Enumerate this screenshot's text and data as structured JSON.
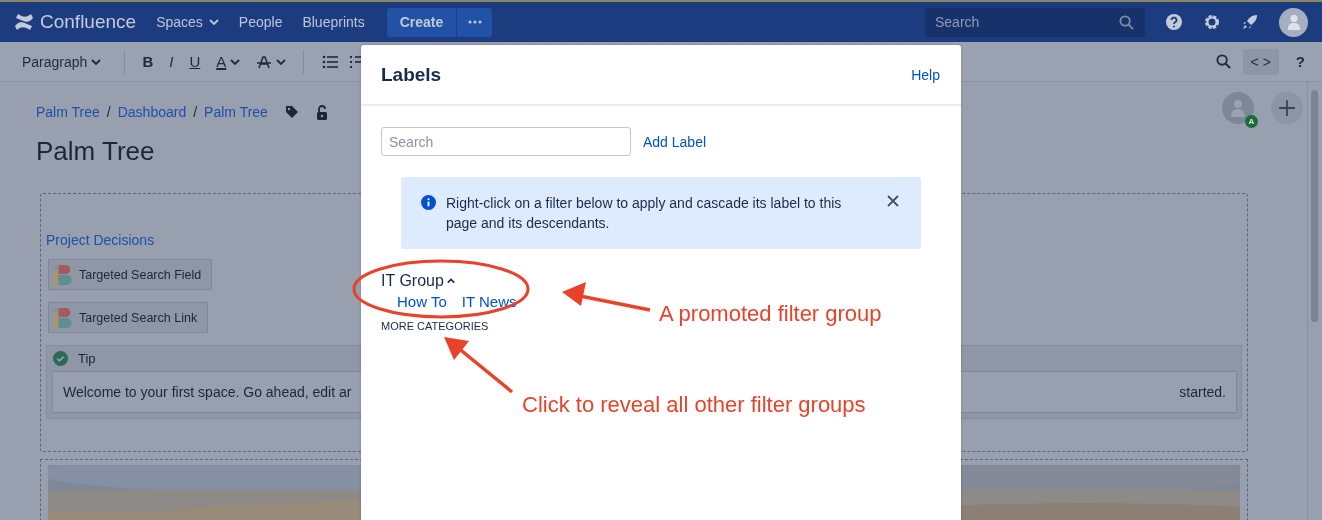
{
  "nav": {
    "logo": "Confluence",
    "items": [
      {
        "label": "Spaces",
        "dropdown": true
      },
      {
        "label": "People",
        "dropdown": false
      },
      {
        "label": "Blueprints",
        "dropdown": false
      }
    ],
    "create": "Create",
    "search": {
      "placeholder": "Search"
    }
  },
  "toolbar": {
    "style": "Paragraph",
    "formats": [
      {
        "kind": "bold",
        "label": "B",
        "dropdown": false
      },
      {
        "kind": "italic",
        "label": "I",
        "dropdown": false
      },
      {
        "kind": "underline",
        "label": "U",
        "dropdown": false
      },
      {
        "kind": "color",
        "label": "A",
        "dropdown": true
      }
    ],
    "source": "< >",
    "help": "?"
  },
  "breadcrumbs": [
    {
      "label": "Palm Tree"
    },
    {
      "separator": "/",
      "label": "Dashboard"
    },
    {
      "separator": "/",
      "label": "Palm Tree"
    }
  ],
  "page_title": "Palm Tree",
  "collaborator_badge": "A",
  "content": {
    "link": "Project Decisions",
    "macros": [
      "Targeted Search Field",
      "Targeted Search Link"
    ],
    "tip": {
      "title": "Tip",
      "text_left": "Welcome to your first space. Go ahead, edit ar",
      "text_right": "started."
    },
    "media": {
      "kind": "picture"
    }
  },
  "dialog": {
    "title": "Labels",
    "help": "Help",
    "search": {
      "placeholder": "Search"
    },
    "add_label": "Add Label",
    "info": "Right-click on a filter below to apply and cascade its label to this page and its descendants.",
    "groups": [
      {
        "name": "IT Group",
        "expanded": true,
        "labels": [
          "How To",
          "IT News"
        ]
      }
    ],
    "more": "MORE CATEGORIES"
  },
  "annotations": [
    {
      "text": "A promoted filter group"
    },
    {
      "text": "Click to reveal all other filter groups"
    }
  ]
}
